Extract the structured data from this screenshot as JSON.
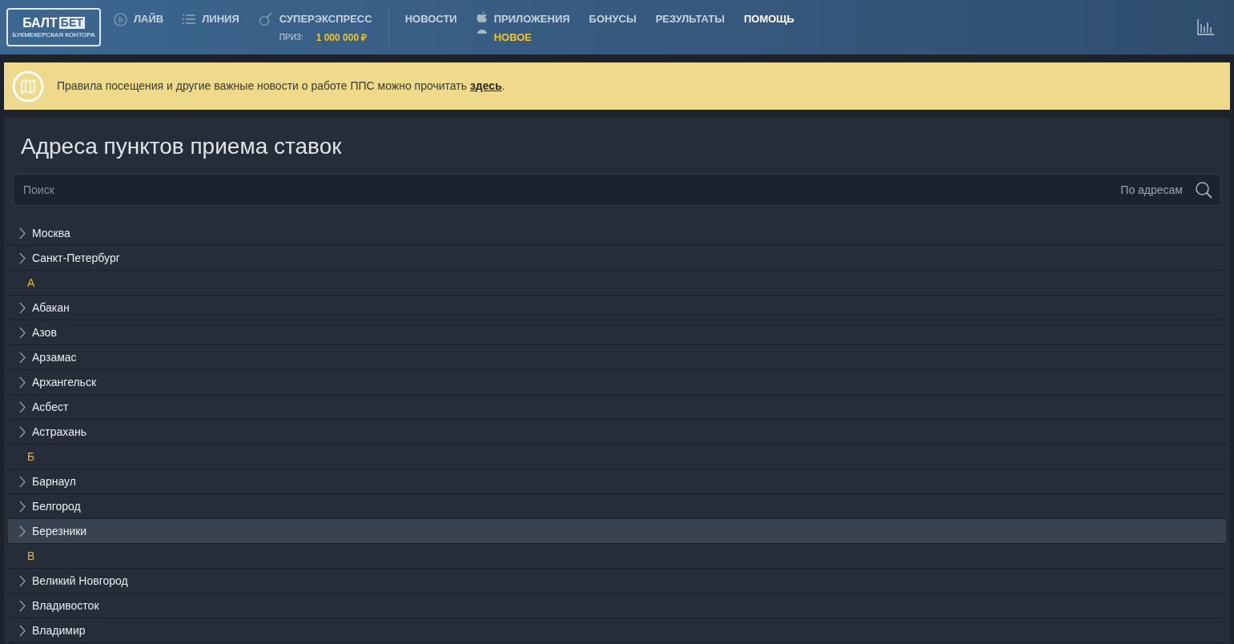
{
  "header": {
    "logo": {
      "word_1": "БАЛТ",
      "word_2": "БЕТ",
      "tagline": "БУКМЕКЕРСКАЯ КОНТОРА"
    },
    "primary_nav": [
      {
        "label": "ЛАЙВ",
        "kind": "play"
      },
      {
        "label": "ЛИНИЯ",
        "kind": "list"
      },
      {
        "label": "СУПЕРЭКСПРЕСС",
        "kind": "ball",
        "prize_label": "ПРИЗ:",
        "prize_value": "1 000 000 ₽"
      }
    ],
    "secondary_nav": [
      {
        "label": "НОВОСТИ",
        "selected": false
      },
      {
        "label": "ПРИЛОЖЕНИЯ",
        "selected": false,
        "badge": "НОВОЕ"
      },
      {
        "label": "БОНУСЫ",
        "selected": false
      },
      {
        "label": "РЕЗУЛЬТАТЫ",
        "selected": false
      },
      {
        "label": "ПОМОЩЬ",
        "selected": true
      }
    ]
  },
  "notice": {
    "text": "Правила посещения и другие важные новости о работе ППС можно прочитать ",
    "link": "здесь",
    "suffix": "."
  },
  "title": "Адреса пунктов приема ставок",
  "search": {
    "placeholder": "Поиск",
    "scope": "По адресам"
  },
  "list": [
    {
      "kind": "city",
      "label": "Москва",
      "selected": false
    },
    {
      "kind": "city",
      "label": "Санкт-Петербург",
      "selected": false
    },
    {
      "kind": "letter",
      "label": "А"
    },
    {
      "kind": "city",
      "label": "Абакан",
      "selected": false
    },
    {
      "kind": "city",
      "label": "Азов",
      "selected": false
    },
    {
      "kind": "city",
      "label": "Арзамас",
      "selected": false
    },
    {
      "kind": "city",
      "label": "Архангельск",
      "selected": false
    },
    {
      "kind": "city",
      "label": "Асбест",
      "selected": false
    },
    {
      "kind": "city",
      "label": "Астрахань",
      "selected": false
    },
    {
      "kind": "letter",
      "label": "Б"
    },
    {
      "kind": "city",
      "label": "Барнаул",
      "selected": false
    },
    {
      "kind": "city",
      "label": "Белгород",
      "selected": false
    },
    {
      "kind": "city",
      "label": "Березники",
      "selected": true
    },
    {
      "kind": "letter",
      "label": "В"
    },
    {
      "kind": "city",
      "label": "Великий Новгород",
      "selected": false
    },
    {
      "kind": "city",
      "label": "Владивосток",
      "selected": false
    },
    {
      "kind": "city",
      "label": "Владимир",
      "selected": false
    }
  ]
}
